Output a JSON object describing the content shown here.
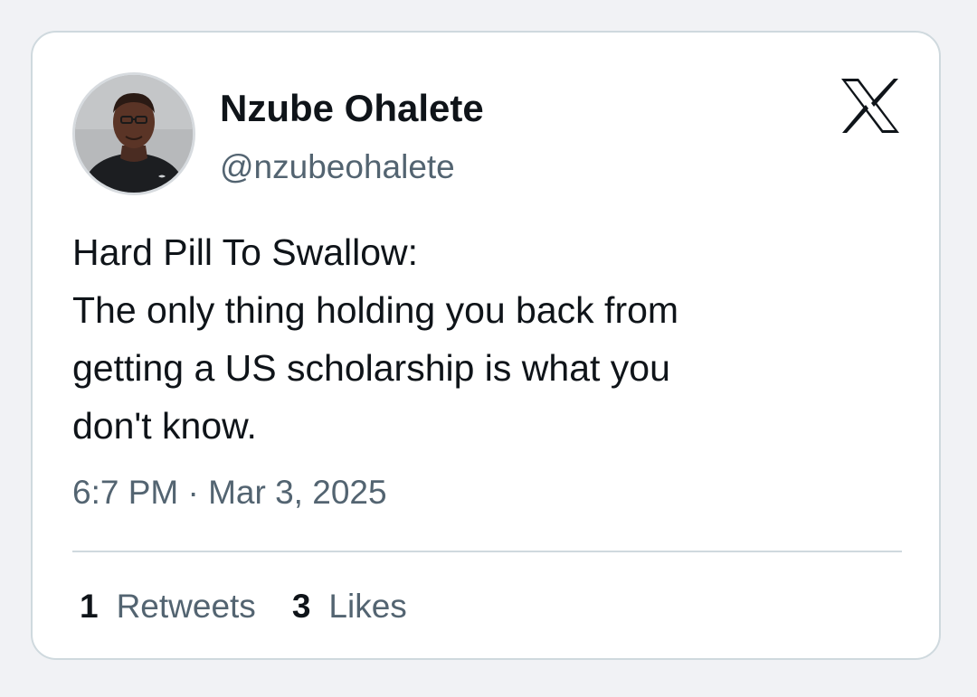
{
  "author": {
    "name": "Nzube Ohalete",
    "handle": "@nzubeohalete"
  },
  "logo_icon": "x-logo-icon",
  "tweet": {
    "lines": [
      "Hard Pill To Swallow:",
      "The only thing holding you back from",
      "getting a US scholarship is what you",
      "don't know."
    ],
    "time": "6:7 PM",
    "separator": "·",
    "date": "Mar 3, 2025"
  },
  "stats": {
    "retweets_count": "1",
    "retweets_label": "Retweets",
    "likes_count": "3",
    "likes_label": "Likes"
  },
  "colors": {
    "text_primary": "#0f1419",
    "text_secondary": "#536471",
    "border": "#cfd9de",
    "background": "#f1f2f5"
  }
}
